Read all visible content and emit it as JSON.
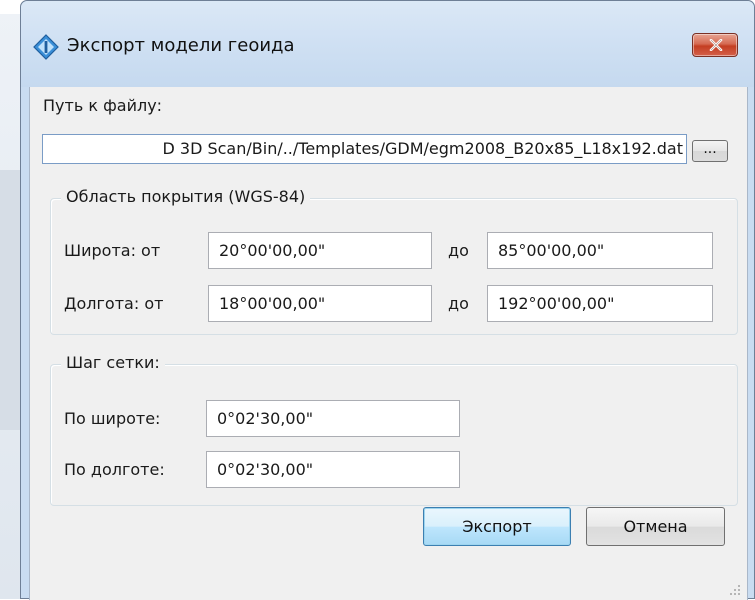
{
  "window": {
    "title": "Экспорт модели геоида",
    "close_label": "×"
  },
  "file": {
    "label": "Путь к файлу:",
    "path_value": "D 3D Scan/Bin/../Templates/GDM/egm2008_B20x85_L18x192.dat",
    "browse_label": "..."
  },
  "coverage": {
    "title": "Область покрытия (WGS-84)",
    "lat_label": "Широта: от",
    "lat_from": "20°00'00,00\"",
    "lat_to_label": "до",
    "lat_to": "85°00'00,00\"",
    "lon_label": "Долгота: от",
    "lon_from": "18°00'00,00\"",
    "lon_to_label": "до",
    "lon_to": "192°00'00,00\""
  },
  "grid_step": {
    "title": "Шаг сетки:",
    "lat_label": "По широте:",
    "lat_value": "0°02'30,00\"",
    "lon_label": "По долготе:",
    "lon_value": "0°02'30,00\""
  },
  "buttons": {
    "export_label": "Экспорт",
    "cancel_label": "Отмена"
  },
  "icons": {
    "app": "geoid-diamond-icon",
    "close": "close-x-icon",
    "grip": "resize-grip-icon"
  },
  "colors": {
    "titlebar": "#cfe0f3",
    "close_button": "#c43e22",
    "default_button_border": "#3c7fb1",
    "client_bg": "#f0f0f0"
  }
}
